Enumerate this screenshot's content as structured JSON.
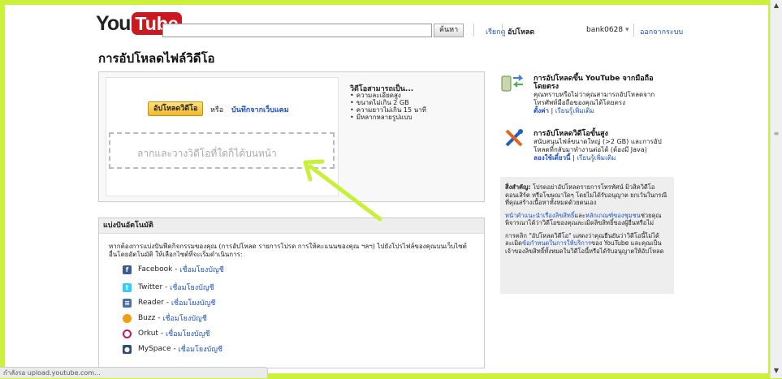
{
  "header": {
    "logo_you": "You",
    "logo_tube": "Tube",
    "search_value": "",
    "search_button": "ค้นหา",
    "browse_link": "เรียกดู",
    "upload_link": "อัปโหลด",
    "username": "bank0628",
    "signout_link": "ออกจากระบบ"
  },
  "page_title": "การอัปโหลดไฟล์วิดีโอ",
  "upload": {
    "button": "อัปโหลดวิดีโอ",
    "or": "หรือ",
    "record": "บันทึกจากเว็บแคม",
    "drop_text": "ลากและวางวิดีโอที่ใดก็ได้บนหน้า",
    "requirements_title": "วิดีโอสามารถเป็น...",
    "requirements": [
      "ความละเอียดสูง",
      "ขนาดไม่เกิน 2 GB",
      "ความยาวไม่เกิน 15 นาที",
      "มีหลากหลายรูปแบบ"
    ]
  },
  "share": {
    "header": "แบ่งปันอัตโนมัติ",
    "description": "หากต้องการแบ่งปันฟีดกิจกรรมของคุณ (การอัปโหลด รายการโปรด การให้คะแนนของคุณ ฯลฯ) ไปยังโปรไฟล์ของคุณบนเว็บไซต์อื่นโดยอัตโนมัติ ให้เลือกไซต์ที่จะเริ่มดำเนินการ:",
    "link_text": "เชื่อมโยงบัญชี",
    "services": [
      {
        "name": "Facebook",
        "icon": "facebook-icon",
        "color": "#3b5998"
      },
      {
        "name": "Twitter",
        "icon": "twitter-icon",
        "color": "#33ccff"
      },
      {
        "name": "Reader",
        "icon": "reader-icon",
        "color": "#4a6fa5"
      },
      {
        "name": "Buzz",
        "icon": "buzz-icon",
        "color": "#f29b13"
      },
      {
        "name": "Orkut",
        "icon": "orkut-icon",
        "color": "#c2185b"
      },
      {
        "name": "MySpace",
        "icon": "myspace-icon",
        "color": "#2c4a7a"
      }
    ]
  },
  "sidebar": {
    "mobile_title": "การอัปโหลดขึ้น YouTube จากมือถือโดยตรง",
    "mobile_desc": "คุณทราบหรือไม่ว่าคุณสามารถอัปโหลดจากโทรศัพท์มือถือของคุณได้โดยตรง",
    "mobile_link1": "ตั้งค่า",
    "mobile_link2": "เรียนรู้เพิ่มเติม",
    "adv_title": "การอัปโหลดวิดีโอขั้นสูง",
    "adv_desc": "สนับสนุนไฟล์ขนาดใหญ่ (>2 GB) และการอัปโหลดที่กลับมาทำงานต่อได้ (ต้องมี Java)",
    "adv_link1": "ลองใช้เดี๋ยวนี้",
    "adv_link2": "เรียนรู้เพิ่มเติม",
    "important_label": "สิ่งสำคัญ:",
    "important_text": "โปรดอย่าอัปโหลดรายการโทรทัศน์ มิวสิควิดีโอ คอนเสิร์ต หรือโฆษณาใดๆ โดยไม่ได้รับอนุญาต ยกเว้นในกรณีที่คุณสร้างเนื้อหาทั้งหมดด้วยตนเอง",
    "copyright_link": "หน้าคำแนะนำเรื่องลิขสิทธิ์",
    "and": "และ",
    "guidelines_link": "หลักเกณฑ์ของชุมชน",
    "guidelines_text": "ช่วยคุณพิจารณาได้ว่าวิดีโอของคุณละเมิดลิขสิทธิ์ของผู้อื่นหรือไม่",
    "terms_pre": "การคลิก \"อัปโหลดวิดีโอ\" แสดงว่าคุณยืนยันว่าวิดีโอนี้ไม่ได้ละเมิด",
    "terms_link": "ข้อกำหนดในการให้บริการ",
    "terms_post": "ของ YouTube และคุณเป็นเจ้าของลิขสิทธิ์ทั้งหมดในวิดีโอนี้หรือได้รับอนุญาตให้อัปโหลด"
  },
  "status_bar": "กำลังรอ upload.youtube.com..."
}
